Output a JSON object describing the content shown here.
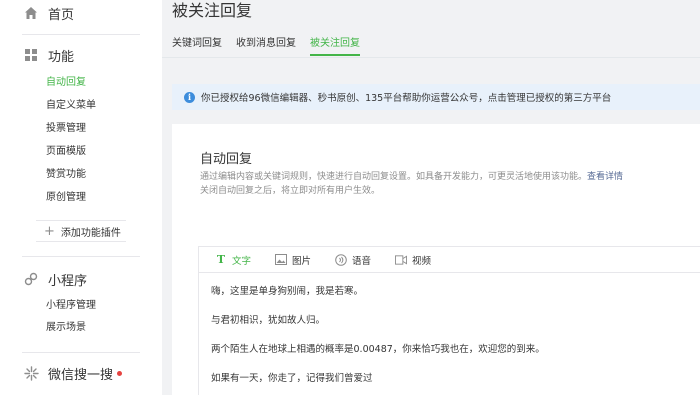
{
  "sidebar": {
    "home": {
      "label": "首页",
      "icon": "home-icon"
    },
    "features": {
      "label": "功能",
      "icon": "grid-icon",
      "items": [
        {
          "label": "自动回复",
          "active": true
        },
        {
          "label": "自定义菜单",
          "active": false
        },
        {
          "label": "投票管理",
          "active": false
        },
        {
          "label": "页面模版",
          "active": false
        },
        {
          "label": "赞赏功能",
          "active": false
        },
        {
          "label": "原创管理",
          "active": false
        }
      ],
      "add_plugin": "添加功能插件"
    },
    "miniprogram": {
      "label": "小程序",
      "icon": "link-icon",
      "items": [
        {
          "label": "小程序管理"
        },
        {
          "label": "展示场景"
        }
      ]
    },
    "search": {
      "label": "微信搜一搜",
      "icon": "sparkle-icon",
      "has_dot": true
    }
  },
  "main": {
    "title": "被关注回复",
    "tabs": [
      {
        "label": "关键词回复",
        "active": false
      },
      {
        "label": "收到消息回复",
        "active": false
      },
      {
        "label": "被关注回复",
        "active": true
      }
    ],
    "notice": "你已授权给96微信编辑器、秒书原创、135平台帮助你运营公众号，点击管理已授权的第三方平台",
    "panel": {
      "title": "自动回复",
      "desc_line1": "通过编辑内容或关键词规则，快速进行自动回复设置。如具备开发能力，可更灵活地使用该功能。",
      "desc_link": "查看详情",
      "desc_line2": "关闭自动回复之后，将立即对所有用户生效。",
      "toolbar": [
        {
          "label": "文字",
          "icon": "text-icon",
          "active": true
        },
        {
          "label": "图片",
          "icon": "image-icon",
          "active": false
        },
        {
          "label": "语音",
          "icon": "voice-icon",
          "active": false
        },
        {
          "label": "视频",
          "icon": "video-icon",
          "active": false
        }
      ],
      "message_lines": [
        "嗨，这里是单身狗别闹，我是若寒。",
        "与君初相识，犹如故人归。",
        "两个陌生人在地球上相遇的概率是0.00487，你来恰巧我也在，欢迎您的到来。",
        "如果有一天，你走了，记得我们曾爱过"
      ]
    }
  },
  "colors": {
    "accent": "#44b549",
    "notice_bg": "#e8f1fb",
    "info": "#3d8ddc",
    "dot": "#e64340"
  }
}
